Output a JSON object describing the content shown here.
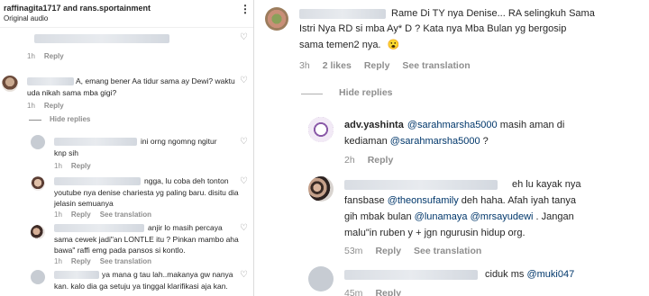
{
  "left": {
    "header": {
      "user": "raffinagita1717 and rans.sportainment",
      "audio": "Original audio",
      "menu": "⋮"
    },
    "c0": {
      "time": "1h",
      "reply": "Reply"
    },
    "c1": {
      "line1": "A, emang bener Aa tidur sama ay Dewi? waktu",
      "line2": "uda nikah sama mba gigi?",
      "time": "1h",
      "reply": "Reply",
      "hide": "Hide replies"
    },
    "r1": {
      "line1": "ini orng ngomng ngitur",
      "line2": "knp sih",
      "time": "1h",
      "reply": "Reply"
    },
    "r2": {
      "line1": "ngga, lu coba deh tonton",
      "line2": "youtube nya denise chariesta yg paling baru. disitu dia",
      "line3": "jelasin semuanya",
      "time": "1h",
      "reply": "Reply",
      "translate": "See translation"
    },
    "r3": {
      "line1": "anjir lo masih percaya",
      "line2": "sama cewek jadi\"an LONTLE itu ? Pinkan mambo aha",
      "line3": "bawa\" raffi emg pada pansos si kontlo.",
      "time": "1h",
      "reply": "Reply",
      "translate": "See translation"
    },
    "r4": {
      "line1": "ya mana g tau lah..makanya gw nanya",
      "line2": "kan. kalo dia ga setuju ya tinggal klarifikasi aja kan.",
      "time": "1h",
      "reply": "Reply",
      "translate": "See translation"
    }
  },
  "right": {
    "c1": {
      "line1": "Rame Di TY nya Denise... RA selingkuh Sama",
      "line2": "Istri Nya RD si mba Ay* D ? Kata nya Mba Bulan yg bergosip",
      "line3": "sama temen2 nya.",
      "emoji": "😮",
      "time": "3h",
      "likes": "2 likes",
      "reply": "Reply",
      "translate": "See translation",
      "hide": "Hide replies"
    },
    "r1": {
      "user": "adv.yashinta",
      "mention1": "@sarahmarsha5000",
      "text1": " masih aman di",
      "line2a": "kediaman ",
      "mention2": "@sarahmarsha5000",
      "line2b": " ?",
      "time": "2h",
      "reply": "Reply"
    },
    "r2": {
      "text1": "eh lu kayak nya",
      "line2a": "fansbase ",
      "mention1": "@theonsufamily",
      "line2b": " deh haha. Afah iyah tanya",
      "line3a": "gih mbak bulan ",
      "mention2": "@lunamaya",
      "mention3": "@mrsayudewi",
      "line3b": " . Jangan",
      "line4": "malu\"in ruben y + jgn ngurusin hidup org.",
      "time": "53m",
      "reply": "Reply",
      "translate": "See translation"
    },
    "r3": {
      "text1": "ciduk ms ",
      "mention1": "@muki047",
      "time": "45m",
      "reply": "Reply"
    }
  }
}
